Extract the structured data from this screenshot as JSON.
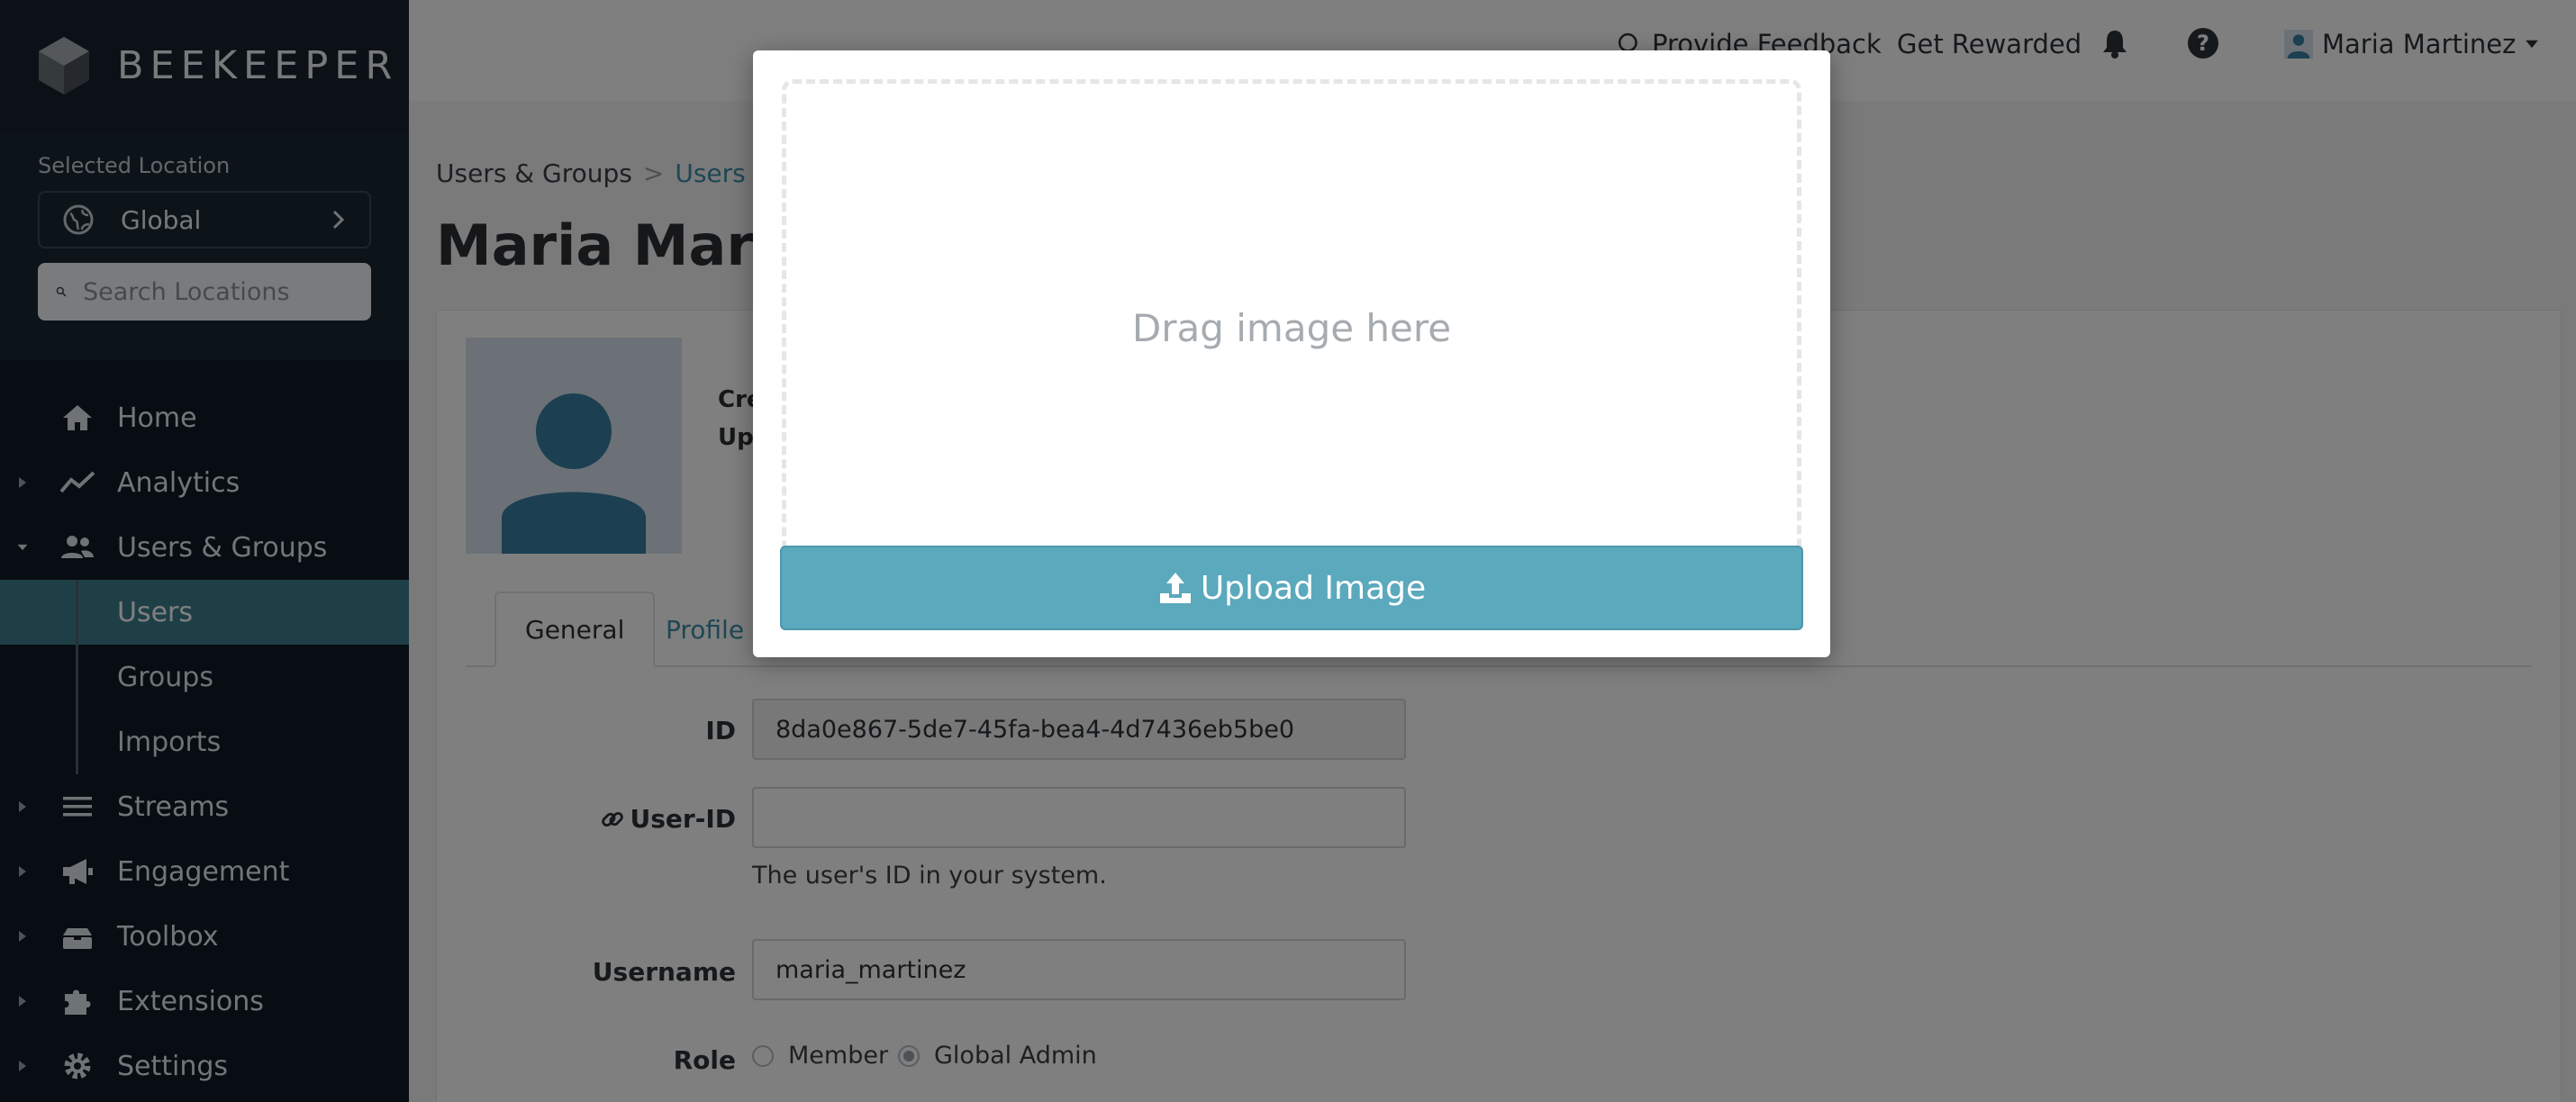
{
  "brand": {
    "name": "BEEKEEPER"
  },
  "location": {
    "title": "Selected Location",
    "selected": "Global",
    "search_placeholder": "Search Locations"
  },
  "nav": {
    "home": "Home",
    "analytics": "Analytics",
    "users_groups": "Users & Groups",
    "users": "Users",
    "groups": "Groups",
    "imports": "Imports",
    "streams": "Streams",
    "engagement": "Engagement",
    "toolbox": "Toolbox",
    "extensions": "Extensions",
    "settings": "Settings"
  },
  "topbar": {
    "feedback": "Provide Feedback",
    "rewarded": "Get Rewarded",
    "user_name": "Maria Martinez"
  },
  "breadcrumb": {
    "parent": "Users & Groups",
    "separator": ">",
    "current": "Users"
  },
  "page": {
    "title": "Maria Martinez"
  },
  "meta": {
    "created_label": "Cre",
    "updated_label": "Upd"
  },
  "tabs": {
    "general": "General",
    "profile": "Profile"
  },
  "form": {
    "id_label": "ID",
    "id_value": "8da0e867-5de7-45fa-bea4-4d7436eb5be0",
    "userid_label": "User-ID",
    "userid_value": "",
    "userid_help": "The user's ID in your system.",
    "username_label": "Username",
    "username_value": "maria_martinez",
    "role_label": "Role",
    "role_options": [
      "Member",
      "Global Admin"
    ],
    "role_selected": "Global Admin"
  },
  "modal": {
    "dropzone_text": "Drag image here",
    "upload_button": "Upload Image"
  },
  "colors": {
    "sidebar_bg": "#0e1a24",
    "active_nav": "#3e7f8f",
    "link": "#3d8fa6",
    "upload_button": "#5ba9bd"
  }
}
